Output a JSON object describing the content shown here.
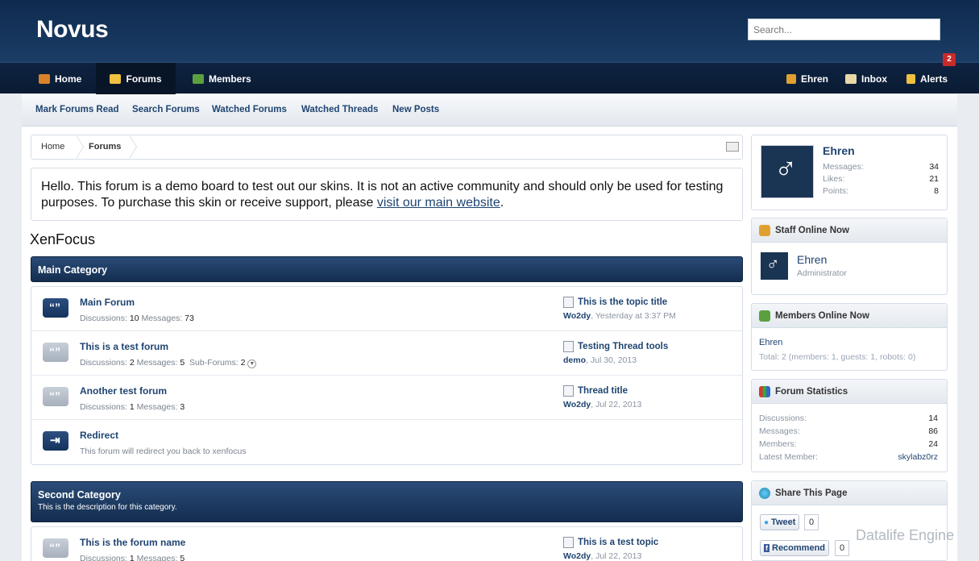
{
  "header": {
    "logo": "Novus",
    "search_placeholder": "Search..."
  },
  "nav": {
    "tabs": [
      {
        "label": "Home",
        "icon": "home-icon"
      },
      {
        "label": "Forums",
        "icon": "forums-icon"
      },
      {
        "label": "Members",
        "icon": "members-icon"
      }
    ],
    "user": "Ehren",
    "inbox": "Inbox",
    "alerts": "Alerts",
    "alerts_badge": "2"
  },
  "subnav": [
    "Mark Forums Read",
    "Search Forums",
    "Watched Forums",
    "Watched Threads",
    "New Posts"
  ],
  "breadcrumb": [
    "Home",
    "Forums"
  ],
  "notice": {
    "text": "Hello. This forum is a demo board to test out our skins. It is not an active community and should only be used for testing purposes. To purchase this skin or receive support, please ",
    "link": "visit our main website",
    "end": "."
  },
  "section_title": "XenFocus",
  "main_category": {
    "title": "Main Category",
    "forums": [
      {
        "name": "Main Forum",
        "discussions_label": "Discussions:",
        "discussions": "10",
        "messages_label": "Messages:",
        "messages": "73",
        "last_title": "This is the topic title",
        "last_user": "Wo2dy",
        "last_date": ", Yesterday at 3:37 PM"
      },
      {
        "name": "This is a test forum",
        "discussions_label": "Discussions:",
        "discussions": "2",
        "messages_label": "Messages:",
        "messages": "5",
        "sub_label": "Sub-Forums:",
        "sub": "2",
        "last_title": "Testing Thread tools",
        "last_user": "demo",
        "last_date": ", Jul 30, 2013"
      },
      {
        "name": "Another test forum",
        "discussions_label": "Discussions:",
        "discussions": "1",
        "messages_label": "Messages:",
        "messages": "3",
        "last_title": "Thread title",
        "last_user": "Wo2dy",
        "last_date": ", Jul 22, 2013"
      },
      {
        "name": "Redirect",
        "desc": "This forum will redirect you back to xenfocus"
      }
    ]
  },
  "second_category": {
    "title": "Second Category",
    "desc": "This is the description for this category.",
    "forums": [
      {
        "name": "This is the forum name",
        "discussions_label": "Discussions:",
        "discussions": "1",
        "messages_label": "Messages:",
        "messages": "5",
        "last_title": "This is a test topic",
        "last_user": "Wo2dy",
        "last_date": ", Jul 22, 2013"
      }
    ]
  },
  "sidebar": {
    "profile": {
      "name": "Ehren",
      "stats": [
        {
          "k": "Messages:",
          "v": "34"
        },
        {
          "k": "Likes:",
          "v": "21"
        },
        {
          "k": "Points:",
          "v": "8"
        }
      ]
    },
    "staff": {
      "title": "Staff Online Now",
      "name": "Ehren",
      "role": "Administrator"
    },
    "members_online": {
      "title": "Members Online Now",
      "name": "Ehren",
      "total": "Total: 2 (members: 1, guests: 1, robots: 0)"
    },
    "stats": {
      "title": "Forum Statistics",
      "rows": [
        {
          "k": "Discussions:",
          "v": "14"
        },
        {
          "k": "Messages:",
          "v": "86"
        },
        {
          "k": "Members:",
          "v": "24"
        },
        {
          "k": "Latest Member:",
          "v": "skylabz0rz"
        }
      ]
    },
    "share": {
      "title": "Share This Page",
      "tweet": "Tweet",
      "tweet_count": "0",
      "recommend": "Recommend",
      "recommend_count": "0"
    }
  },
  "watermark": "Datalife Engine",
  "colors": {
    "header": "#1b3d66",
    "link": "#1f4471",
    "badge": "#c92a2a"
  }
}
